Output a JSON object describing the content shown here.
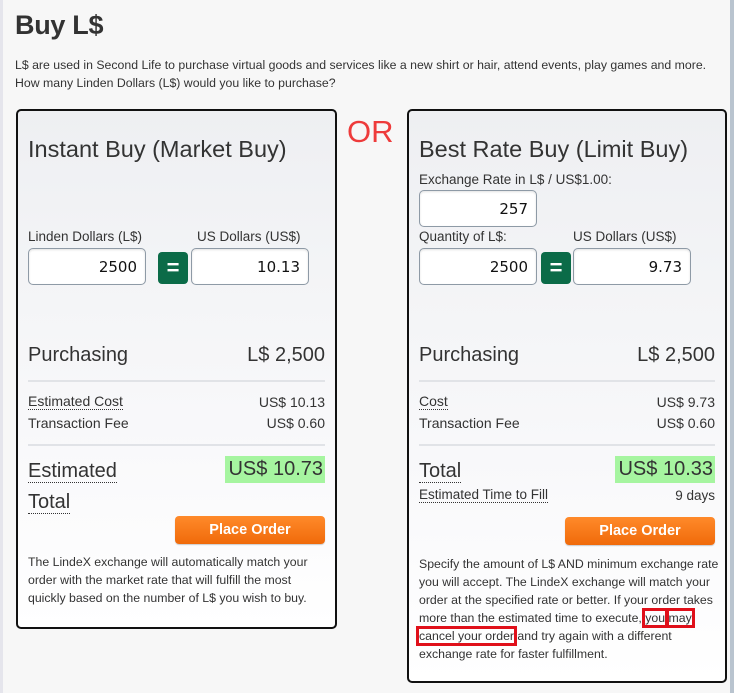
{
  "page": {
    "title": "Buy L$",
    "intro_line1": "L$ are used in Second Life to purchase virtual goods and services like a new shirt or hair, attend events, play games and more.",
    "intro_line2": "How many Linden Dollars (L$) would you like to purchase?",
    "or_label": "OR"
  },
  "instant_buy": {
    "title": "Instant Buy (Market Buy)",
    "linden_label": "Linden Dollars (L$)",
    "linden_value": "2500",
    "usd_label": "US Dollars (US$)",
    "usd_value": "10.13",
    "equals_label": "=",
    "purchasing_label": "Purchasing",
    "purchasing_value": "L$ 2,500",
    "cost_label": "Estimated Cost",
    "cost_value": "US$ 10.13",
    "fee_label": "Transaction Fee",
    "fee_value": "US$ 0.60",
    "total_label_line1": "Estimated",
    "total_label_line2": "Total",
    "total_value": "US$ 10.73",
    "button_label": "Place Order",
    "description": "The LindeX exchange will automatically match your order with the market rate that will fulfill the most quickly based on the number of L$ you wish to buy."
  },
  "best_rate_buy": {
    "title": "Best Rate Buy (Limit Buy)",
    "rate_label": "Exchange Rate in L$ / US$1.00:",
    "rate_value": "257",
    "quantity_label": "Quantity of L$:",
    "quantity_value": "2500",
    "usd_label": "US Dollars (US$)",
    "usd_value": "9.73",
    "equals_label": "=",
    "purchasing_label": "Purchasing",
    "purchasing_value": "L$ 2,500",
    "cost_label": "Cost",
    "cost_value": "US$ 9.73",
    "fee_label": "Transaction Fee",
    "fee_value": "US$ 0.60",
    "total_label": "Total",
    "total_value": "US$ 10.33",
    "time_label": "Estimated Time to Fill",
    "time_value": "9 days",
    "button_label": "Place Order",
    "description_part1": "Specify the amount of L$ AND minimum exchange rate you will accept. The LindeX exchange will match your order at the specified rate or better. If your order takes more than the estimated time to execute, ",
    "description_highlight1": "you",
    "description_highlight2": "may cancel your order",
    "description_part2": " and try again with a different exchange rate for faster fulfillment."
  },
  "colors": {
    "equals_button": "#0b6b48",
    "place_order": "#f37a1f",
    "total_highlight": "#a6f5a0",
    "or_text": "#ee3b3b",
    "annotation_box": "#e0101a"
  }
}
